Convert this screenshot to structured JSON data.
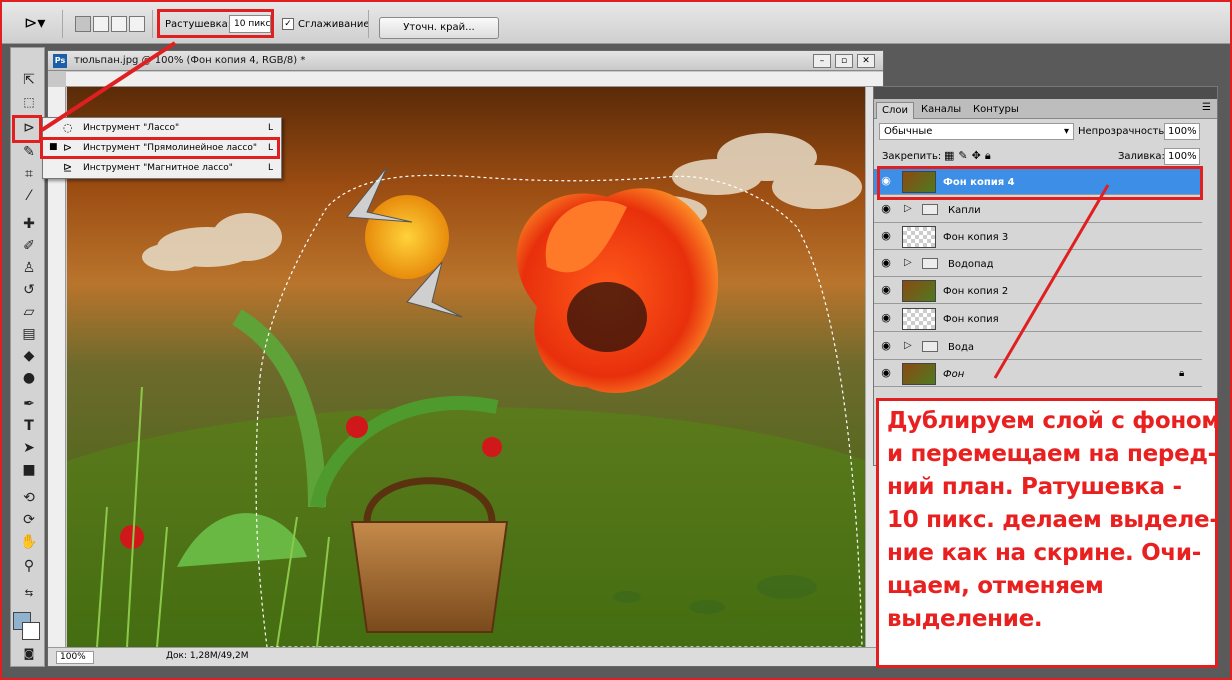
{
  "options_bar": {
    "feather_label": "Растушевка:",
    "feather_value": "10 пикс",
    "antialias_checked": "✓",
    "antialias_label": "Сглаживание",
    "refine_edge_label": "Уточн. край..."
  },
  "document": {
    "title": "тюльпан.jpg @ 100% (Фон копия 4, RGB/8) *",
    "zoom": "100%",
    "doc_info": "Док: 1,28M/49,2M"
  },
  "tool_flyout": {
    "items": [
      {
        "label": "Инструмент \"Лассо\"",
        "shortcut": "L",
        "selected": false
      },
      {
        "label": "Инструмент \"Прямолинейное лассо\"",
        "shortcut": "L",
        "selected": true
      },
      {
        "label": "Инструмент \"Магнитное лассо\"",
        "shortcut": "L",
        "selected": false
      }
    ]
  },
  "layers_panel": {
    "tabs": [
      "Слои",
      "Каналы",
      "Контуры"
    ],
    "blend_mode": "Обычные",
    "opacity_label": "Непрозрачность:",
    "opacity": "100%",
    "lock_label": "Закрепить:",
    "fill_label": "Заливка:",
    "fill": "100%",
    "layers": [
      {
        "name": "Фон копия 4",
        "kind": "image",
        "selected": true
      },
      {
        "name": "Капли",
        "kind": "group"
      },
      {
        "name": "Фон копия 3",
        "kind": "transparent"
      },
      {
        "name": "Водопад",
        "kind": "group"
      },
      {
        "name": "Фон копия 2",
        "kind": "image"
      },
      {
        "name": "Фон копия",
        "kind": "transparent"
      },
      {
        "name": "Вода",
        "kind": "group"
      },
      {
        "name": "Фон",
        "kind": "image",
        "locked": true
      }
    ]
  },
  "annotation": {
    "text": "Дублируем слой с фоном\nи перемещаем на перед-\nний план. Ратушевка -\n10 пикс. делаем выделе-\nние как на скрине. Очи-\nщаем, отменяем\nвыделение."
  },
  "colors": {
    "highlight": "#e02020",
    "selection_blue": "#3d8ee6",
    "foreground": "#8fb3cf",
    "background": "#ffffff"
  }
}
